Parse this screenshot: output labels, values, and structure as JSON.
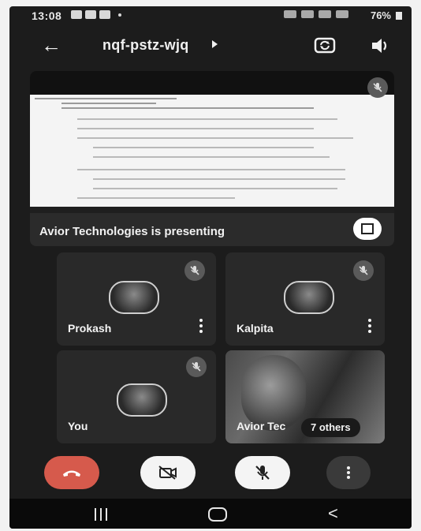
{
  "status_bar": {
    "time": "13:08",
    "battery": "76%"
  },
  "meeting": {
    "code": "nqf-pstz-wjq",
    "icons": {
      "back": "back-arrow-icon",
      "details": "caret-right-icon",
      "switch_camera": "switch-camera-icon",
      "audio": "speaker-icon"
    }
  },
  "presentation": {
    "presenting_label": "Avior Technologies is presenting",
    "fullscreen_icon": "fullscreen-icon"
  },
  "participants": [
    {
      "name": "Prokash",
      "muted": true,
      "has_video": false
    },
    {
      "name": "Kalpita",
      "muted": true,
      "has_video": false
    },
    {
      "name": "You",
      "muted": true,
      "has_video": false
    },
    {
      "name": "Avior Tec",
      "muted": false,
      "has_video": true
    }
  ],
  "others_chip": "7 others",
  "controls": {
    "end_call": "end-call-icon",
    "camera": "camera-off-icon",
    "microphone": "mic-off-icon",
    "more": "more-options-icon",
    "colors": {
      "end_call": "#d65a4c",
      "light": "#f4f4f4",
      "dark": "#3a3a3a"
    }
  },
  "nav_bar": {
    "recent_apps": "recent-apps-icon",
    "home": "home-icon",
    "back": "nav-back-icon"
  }
}
